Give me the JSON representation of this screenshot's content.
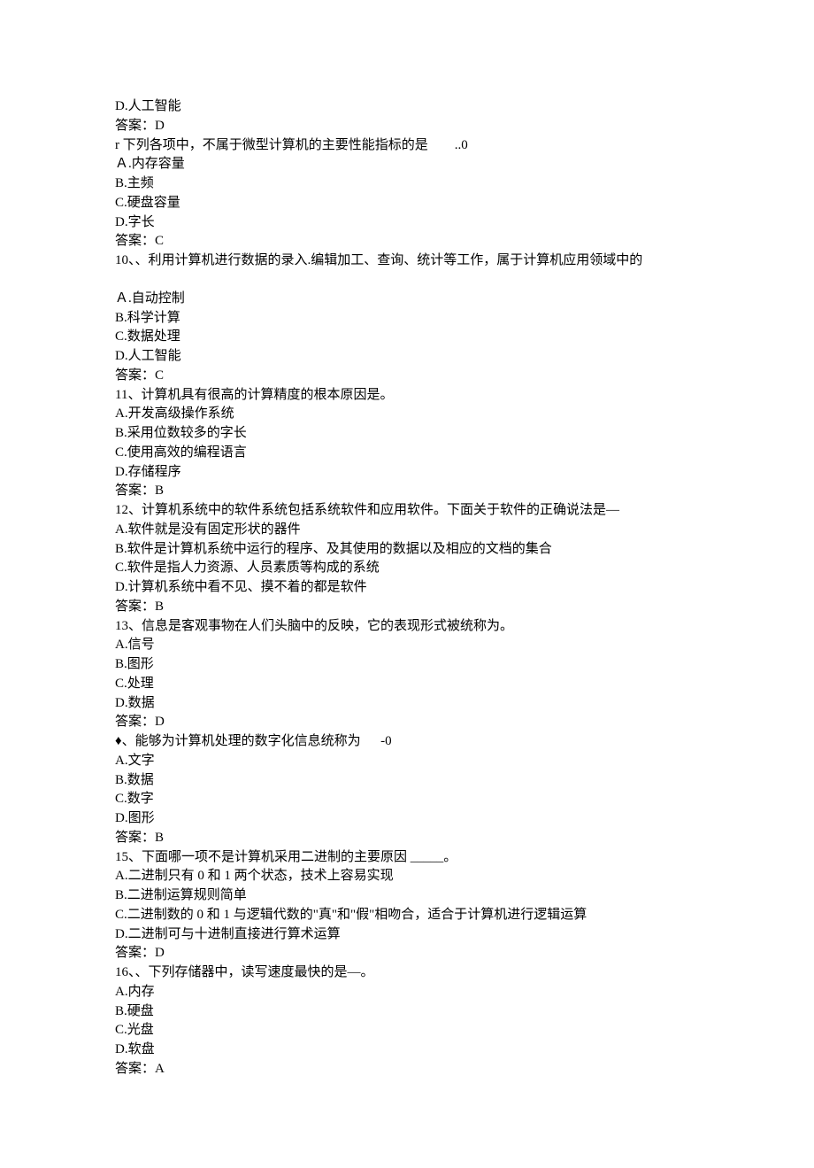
{
  "lines": [
    "D.人工智能",
    "答案：D",
    "r 下列各项中，不属于微型计算机的主要性能指标的是        ..0",
    "Ａ.内存容量",
    "B.主频",
    "C.硬盘容量",
    "D.字长",
    "答案：C",
    "10、、利用计算机进行数据的录入.编辑加工、查询、统计等工作，属于计算机应用领域中的",
    "",
    "Ａ.自动控制",
    "B.科学计算",
    "C.数据处理",
    "D.人工智能",
    "答案：C",
    "11、计算机具有很高的计算精度的根本原因是。",
    "A.开发高级操作系统",
    "B.采用位数较多的字长",
    "C.使用高效的编程语言",
    "D.存储程序",
    "答案：B",
    "12、计算机系统中的软件系统包括系统软件和应用软件。下面关于软件的正确说法是—",
    "A.软件就是没有固定形状的器件",
    "B.软件是计算机系统中运行的程序、及其使用的数据以及相应的文档的集合",
    "C.软件是指人力资源、人员素质等构成的系统",
    "D.计算机系统中看不见、摸不着的都是软件",
    "答案：B",
    "13、信息是客观事物在人们头脑中的反映，它的表现形式被统称为。",
    "A.信号",
    "B.图形",
    "C.处理",
    "D.数据",
    "答案：D",
    "♦、能够为计算机处理的数字化信息统称为      -0",
    "A.文字",
    "B.数据",
    "C.数字",
    "D.图形",
    "答案：B",
    "15、下面哪一项不是计算机采用二进制的主要原因 _____。",
    "A.二进制只有 0 和 1 两个状态，技术上容易实现",
    "B.二进制运算规则简单",
    "C.二进制数的 0 和 1 与逻辑代数的\"真\"和\"假\"相吻合，适合于计算机进行逻辑运算",
    "D.二进制可与十进制直接进行算术运算",
    "答案：D",
    "16、、下列存储器中，读写速度最快的是—。",
    "A.内存",
    "B.硬盘",
    "C.光盘",
    "D.软盘",
    "答案：A"
  ]
}
